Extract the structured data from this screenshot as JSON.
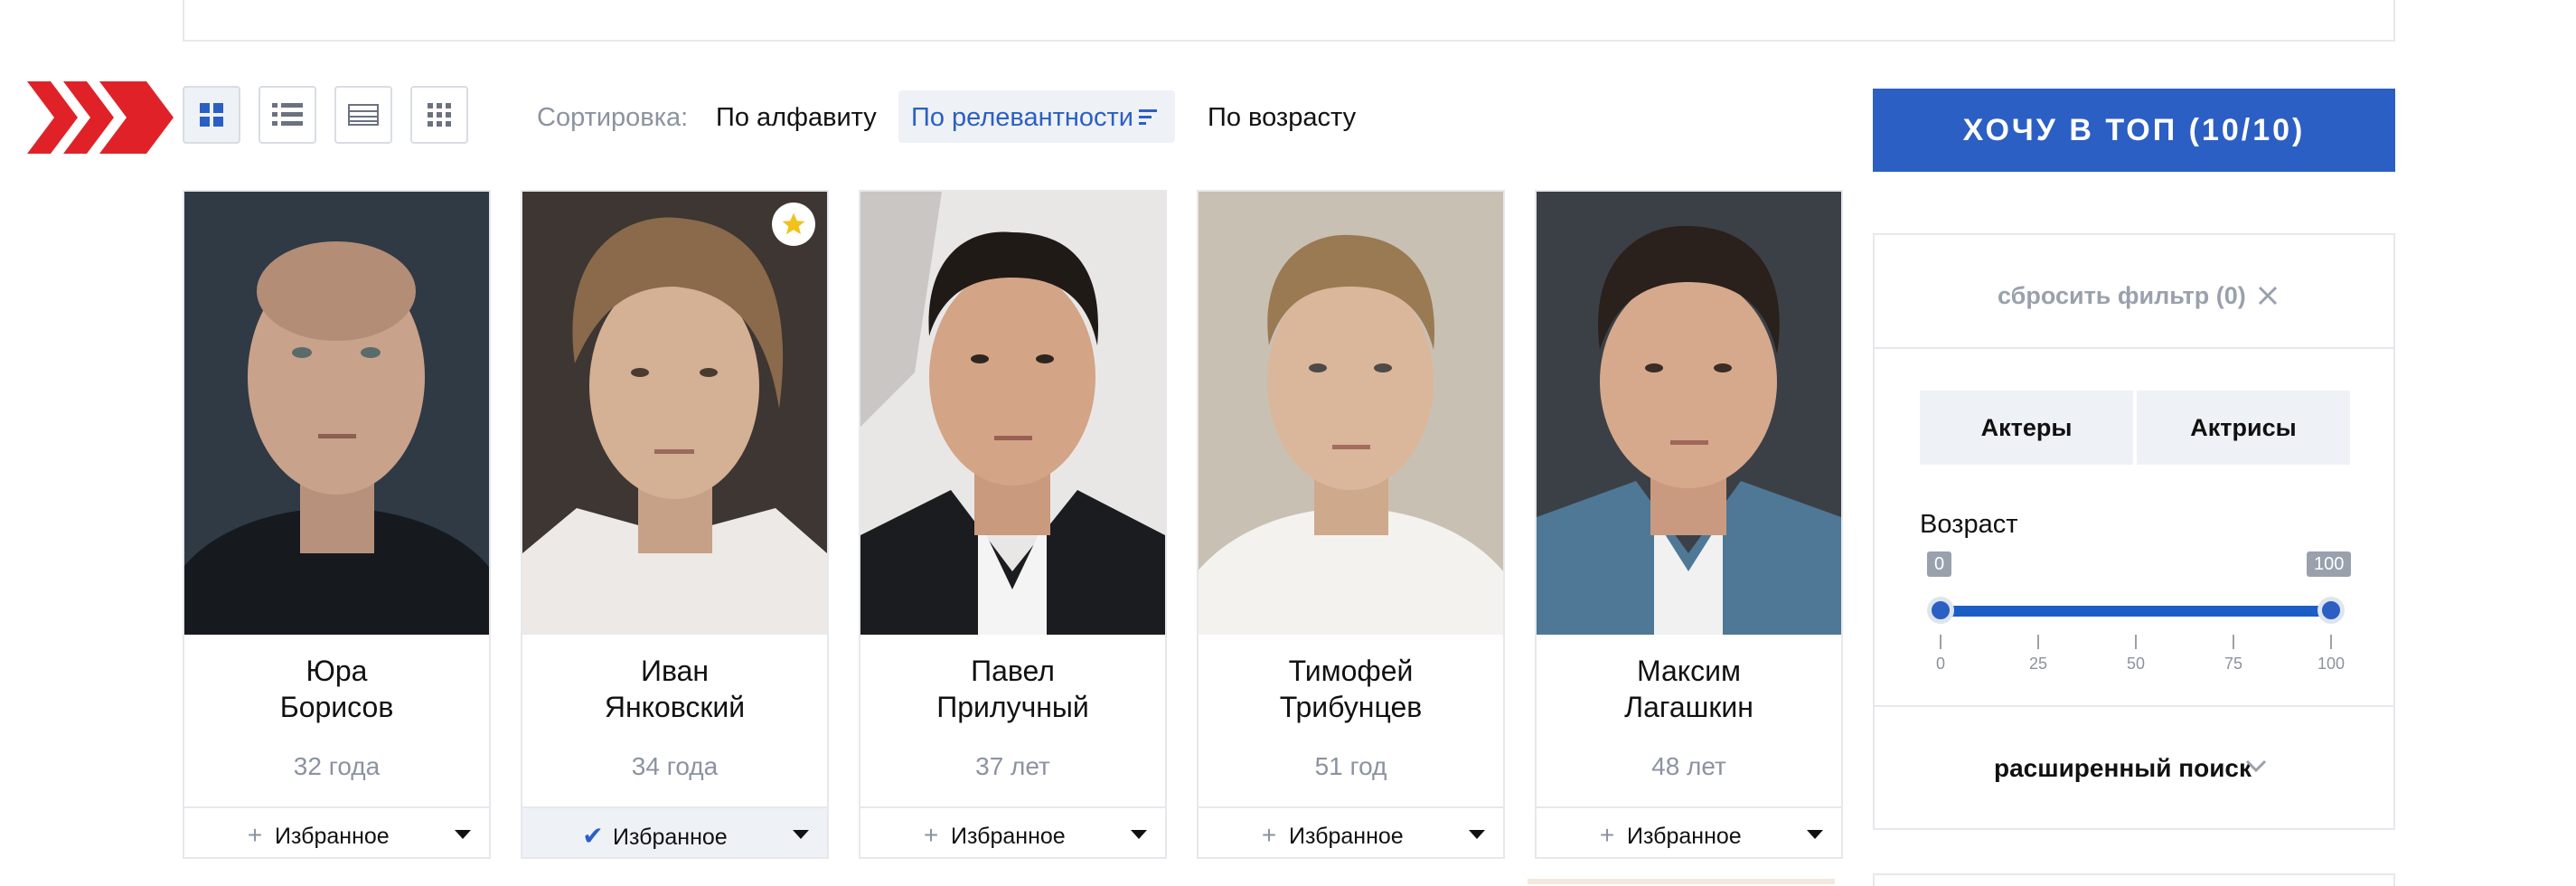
{
  "toolbar": {
    "view_modes": [
      "grid-large",
      "list",
      "table",
      "grid-small"
    ],
    "active_view": "grid-large",
    "sort_label": "Сортировка:",
    "sort_options": [
      "По алфавиту",
      "По релевантности",
      "По возрасту"
    ],
    "active_sort": "По релевантности"
  },
  "top_button": {
    "label": "ХОЧУ В ТОП (10/10)"
  },
  "cards": [
    {
      "first_name": "Юра",
      "last_name": "Борисов",
      "age": "32 года",
      "favorite_label": "Избранное",
      "favorited": false,
      "starred": false
    },
    {
      "first_name": "Иван",
      "last_name": "Янковский",
      "age": "34 года",
      "favorite_label": "Избранное",
      "favorited": true,
      "starred": true
    },
    {
      "first_name": "Павел",
      "last_name": "Прилучный",
      "age": "37 лет",
      "favorite_label": "Избранное",
      "favorited": false,
      "starred": false
    },
    {
      "first_name": "Тимофей",
      "last_name": "Трибунцев",
      "age": "51 год",
      "favorite_label": "Избранное",
      "favorited": false,
      "starred": false
    },
    {
      "first_name": "Максим",
      "last_name": "Лагашкин",
      "age": "48 лет",
      "favorite_label": "Избранное",
      "favorited": false,
      "starred": false
    }
  ],
  "filter": {
    "reset_label": "сбросить фильтр (0)",
    "gender_tabs": [
      "Актеры",
      "Актрисы"
    ],
    "age_label": "Возраст",
    "age_min": "0",
    "age_max": "100",
    "age_ticks": [
      "0",
      "25",
      "50",
      "75",
      "100"
    ],
    "advanced_label": "расширенный поиск"
  },
  "colors": {
    "accent": "#2b5fc4",
    "chevron_red": "#e02228",
    "muted_text": "#8b93a0",
    "border": "#e6e8ec",
    "light_bg": "#eef1f6"
  }
}
